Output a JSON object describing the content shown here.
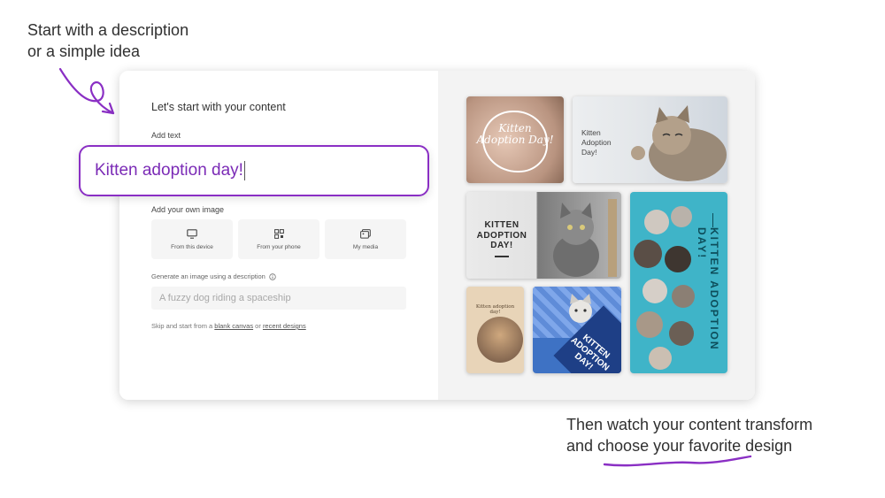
{
  "annotations": {
    "top_line1": "Start with a description",
    "top_line2": "or a simple idea",
    "bottom_line1": "Then watch your content transform",
    "bottom_line2": "and choose your favorite design"
  },
  "panel": {
    "title": "Let's start with your content",
    "add_text_label": "Add text",
    "text_value": "Kitten adoption day!",
    "add_image_label": "Add your own image",
    "sources": [
      {
        "label": "From this device",
        "icon": "monitor-icon"
      },
      {
        "label": "From your phone",
        "icon": "qr-code-icon"
      },
      {
        "label": "My media",
        "icon": "media-icon"
      }
    ],
    "generate_label": "Generate an image using a description",
    "generate_placeholder": "A fuzzy dog riding a spaceship",
    "skip_prefix": "Skip and start from a",
    "skip_link1": "blank canvas",
    "skip_mid": "or",
    "skip_link2": "recent designs"
  },
  "designs": [
    {
      "text": "Kitten Adoption Day!"
    },
    {
      "text_lines": [
        "Kitten",
        "Adoption",
        "Day!"
      ]
    },
    {
      "text_lines": [
        "KITTEN",
        "ADOPTION",
        "DAY!"
      ]
    },
    {
      "text": "KITTEN ADOPTION DAY!"
    },
    {
      "text": "Kitten adoption day!"
    },
    {
      "text_lines": [
        "KITTEN",
        "ADOPTION",
        "DAY!"
      ]
    }
  ],
  "colors": {
    "accent": "#8a2fc4",
    "accent_text": "#7b2bb6"
  }
}
